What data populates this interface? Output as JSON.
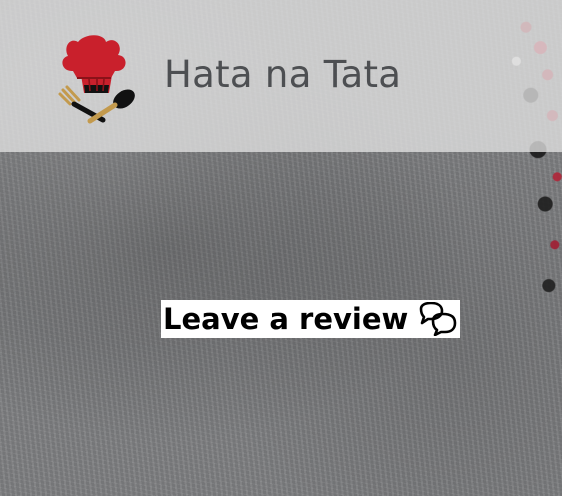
{
  "header": {
    "site_name": "Hata na Tata",
    "logo_icon": "chef-hat-utensils-icon"
  },
  "main": {
    "review_link_label": "Leave a review",
    "review_icon": "chat-bubbles-icon"
  },
  "colors": {
    "header_overlay": "#e2e2e2",
    "title_text": "#4d4f52",
    "review_background": "#ffffff",
    "review_text": "#000000",
    "logo_red": "#c9202c",
    "logo_black": "#111111",
    "utensil_gold": "#c39a4d"
  }
}
